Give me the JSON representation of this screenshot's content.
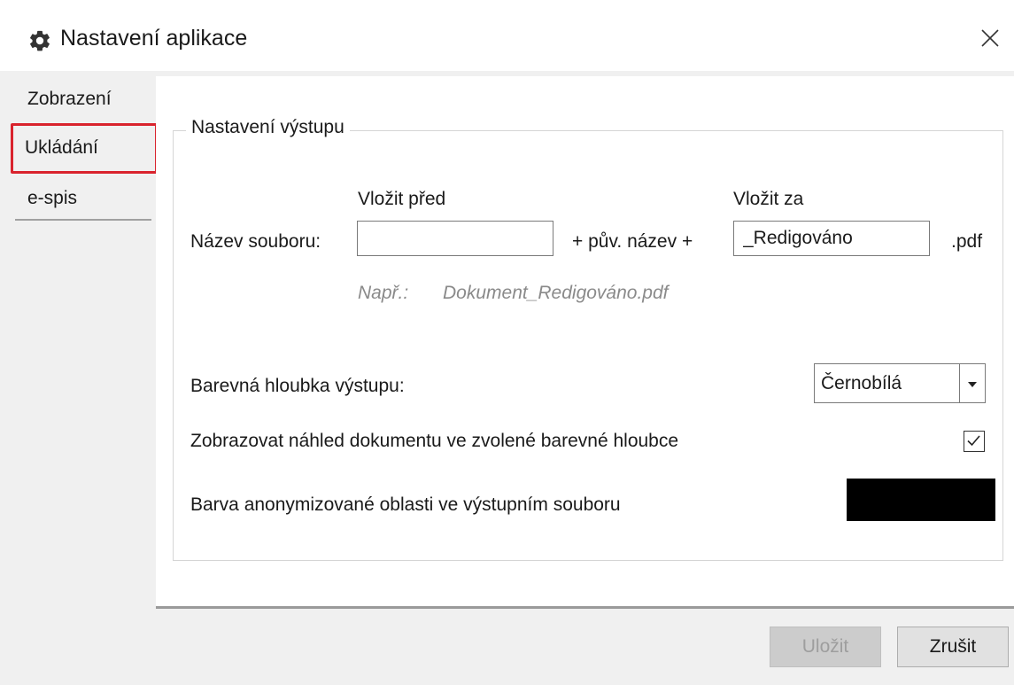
{
  "window": {
    "title": "Nastavení aplikace",
    "title_icon": "gear-icon",
    "close_icon": "close-icon"
  },
  "tabs": [
    {
      "label": "Zobrazení"
    },
    {
      "label": "Ukládání",
      "active": true,
      "highlighted": true
    },
    {
      "label": "e-spis"
    }
  ],
  "output": {
    "group_label": "Nastavení výstupu",
    "before_label": "Vložit před",
    "after_label": "Vložit za",
    "filename_label": "Název souboru:",
    "before_value": "",
    "middle_text": "+ pův. název +",
    "after_value": "_Redigováno",
    "extension": ".pdf",
    "example_label": "Např.:",
    "example_value": "Dokument_Redigováno.pdf",
    "color_depth_label": "Barevná hloubka výstupu:",
    "color_depth_value": "Černobílá",
    "preview_label": "Zobrazovat náhled dokumentu ve zvolené barevné hloubce",
    "preview_checked": true,
    "area_color_label": "Barva anonymizované oblasti ve výstupním souboru",
    "area_color": "#000000"
  },
  "buttons": {
    "save": "Uložit",
    "save_enabled": false,
    "cancel": "Zrušit"
  },
  "colors": {
    "highlight": "#d9232d",
    "partial_heading": "#c00000"
  }
}
